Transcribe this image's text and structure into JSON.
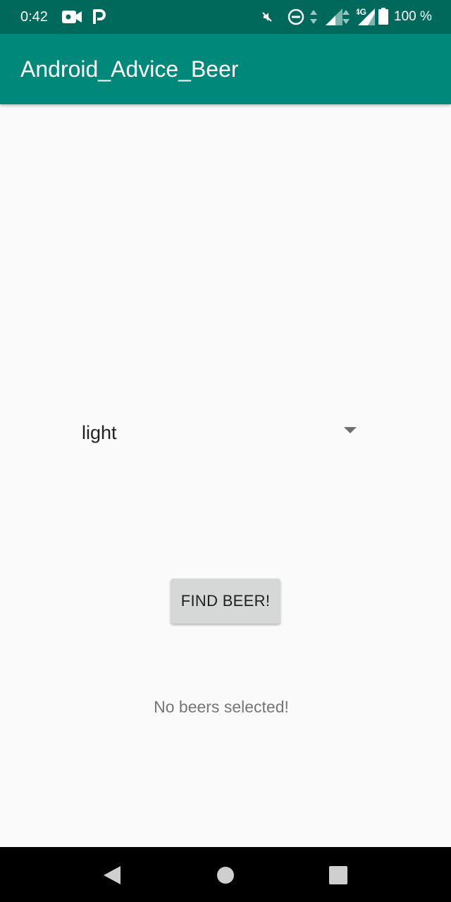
{
  "status_bar": {
    "time": "0:42",
    "battery_text": "100 %",
    "network_label": "4G",
    "icons": [
      "video-camera-icon",
      "parking-icon",
      "mute-icon",
      "do-not-disturb-icon",
      "data-arrows-icon",
      "signal-icon",
      "signal-4g-icon",
      "battery-icon"
    ]
  },
  "app_bar": {
    "title": "Android_Advice_Beer",
    "color": "#00897b",
    "status_color": "#00695c"
  },
  "main": {
    "spinner": {
      "selected_value": "light",
      "icon": "dropdown-arrow-icon"
    },
    "find_button_label": "FIND BEER!",
    "result_text": "No beers selected!"
  },
  "nav_bar": {
    "buttons": [
      "back-icon",
      "home-icon",
      "recents-icon"
    ]
  }
}
